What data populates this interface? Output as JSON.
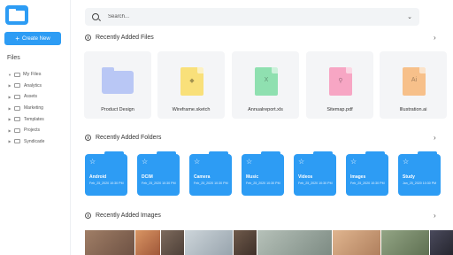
{
  "sidebar": {
    "create_label": "Create New",
    "files_label": "Files",
    "root": "My Files",
    "items": [
      "Analytics",
      "Assets",
      "Marketing",
      "Templates",
      "Projects",
      "Syndicade"
    ]
  },
  "search": {
    "placeholder": "Search..."
  },
  "sections": {
    "files": "Recently Added Files",
    "folders": "Recently Added Folders",
    "images": "Recently Added Images"
  },
  "files": [
    {
      "name": "Product Design",
      "icon": "folder-icon",
      "color": "#b9c7f5"
    },
    {
      "name": "Wireframe.sketch",
      "icon": "sketch-icon",
      "color": "#f9e07a",
      "glyph": "◆"
    },
    {
      "name": "Annualreport.xls",
      "icon": "excel-icon",
      "color": "#8fe0b0",
      "glyph": "X"
    },
    {
      "name": "Sitemap.pdf",
      "icon": "pdf-icon",
      "color": "#f7a6c4",
      "glyph": "⚲"
    },
    {
      "name": "Illustration.ai",
      "icon": "illustrator-icon",
      "color": "#f7c08a",
      "glyph": "Ai"
    }
  ],
  "folders": [
    {
      "name": "Android",
      "date": "Feb_25_2020 10:30 PM"
    },
    {
      "name": "DCIM",
      "date": "Feb_25_2020 10:30 PM"
    },
    {
      "name": "Camera",
      "date": "Feb_25_2020 10:30 PM"
    },
    {
      "name": "Music",
      "date": "Feb_25_2020 10:30 PM"
    },
    {
      "name": "Videos",
      "date": "Feb_25_2020 10:30 PM"
    },
    {
      "name": "Images",
      "date": "Feb_25_2020 10:30 PM"
    },
    {
      "name": "Study",
      "date": "Jan_25_2020 10:30 PM"
    }
  ],
  "images": [
    {
      "icon": "photo-woman-smiling",
      "color": "#8a6a55"
    },
    {
      "icon": "photo-woman-redhair",
      "color": "#c77a4f"
    },
    {
      "icon": "photo-woman-dark",
      "color": "#6b5a4e"
    },
    {
      "icon": "photo-woman-headphones",
      "color": "#b8c2c9"
    },
    {
      "icon": "photo-man-portrait",
      "color": "#5e4c40"
    },
    {
      "icon": "photo-man-outdoor",
      "color": "#9aa7a0"
    },
    {
      "icon": "photo-woman-blonde",
      "color": "#d4a47e"
    },
    {
      "icon": "photo-woman-outdoor",
      "color": "#7a8c6e"
    },
    {
      "icon": "photo-woman-night",
      "color": "#3a3a4a"
    }
  ],
  "accent": "#2d9cf4"
}
